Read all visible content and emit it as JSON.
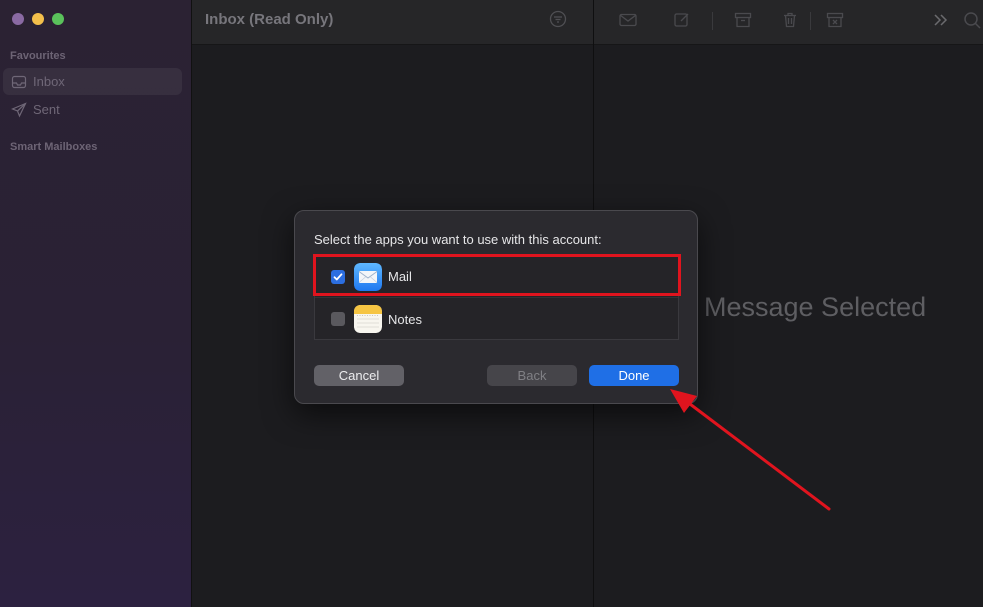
{
  "sidebar": {
    "favourites_label": "Favourites",
    "items": [
      {
        "label": "Inbox",
        "icon": "inbox-icon",
        "active": true
      },
      {
        "label": "Sent",
        "icon": "paperplane-icon",
        "active": false
      }
    ],
    "smart_mailboxes_label": "Smart Mailboxes"
  },
  "message_list": {
    "title": "Inbox (Read Only)"
  },
  "viewer": {
    "empty_text": "Message Selected"
  },
  "dialog": {
    "prompt": "Select the apps you want to use with this account:",
    "apps": [
      {
        "name": "Mail",
        "checked": true,
        "icon": "mail-app-icon"
      },
      {
        "name": "Notes",
        "checked": false,
        "icon": "notes-app-icon"
      }
    ],
    "cancel_label": "Cancel",
    "back_label": "Back",
    "done_label": "Done"
  },
  "colors": {
    "accent": "#1f6fe6",
    "annotation": "#e0141e"
  }
}
